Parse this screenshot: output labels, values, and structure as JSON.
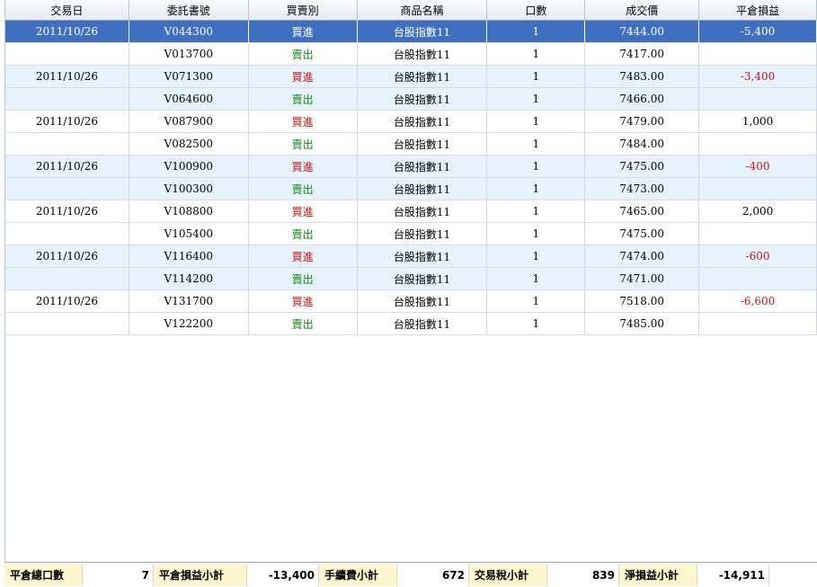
{
  "columns": [
    "交易日",
    "委託書號",
    "買賣別",
    "商品名稱",
    "口數",
    "成交價",
    "平倉損益"
  ],
  "rows": [
    {
      "date": "2011/10/26",
      "order": "V044300",
      "side": "買進",
      "side_type": "buy",
      "product": "台股指數11",
      "qty": "1",
      "price": "7444.00",
      "pnl": "-5,400",
      "pnl_type": "neg",
      "style": "sel"
    },
    {
      "date": "",
      "order": "V013700",
      "side": "賣出",
      "side_type": "sell",
      "product": "台股指數11",
      "qty": "1",
      "price": "7417.00",
      "pnl": "",
      "pnl_type": "",
      "style": "plain"
    },
    {
      "date": "2011/10/26",
      "order": "V071300",
      "side": "買進",
      "side_type": "buy",
      "product": "台股指數11",
      "qty": "1",
      "price": "7483.00",
      "pnl": "-3,400",
      "pnl_type": "neg",
      "style": "alt"
    },
    {
      "date": "",
      "order": "V064600",
      "side": "賣出",
      "side_type": "sell",
      "product": "台股指數11",
      "qty": "1",
      "price": "7466.00",
      "pnl": "",
      "pnl_type": "",
      "style": "alt"
    },
    {
      "date": "2011/10/26",
      "order": "V087900",
      "side": "買進",
      "side_type": "buy",
      "product": "台股指數11",
      "qty": "1",
      "price": "7479.00",
      "pnl": "1,000",
      "pnl_type": "pos",
      "style": "plain"
    },
    {
      "date": "",
      "order": "V082500",
      "side": "賣出",
      "side_type": "sell",
      "product": "台股指數11",
      "qty": "1",
      "price": "7484.00",
      "pnl": "",
      "pnl_type": "",
      "style": "plain"
    },
    {
      "date": "2011/10/26",
      "order": "V100900",
      "side": "買進",
      "side_type": "buy",
      "product": "台股指數11",
      "qty": "1",
      "price": "7475.00",
      "pnl": "-400",
      "pnl_type": "neg",
      "style": "alt"
    },
    {
      "date": "",
      "order": "V100300",
      "side": "賣出",
      "side_type": "sell",
      "product": "台股指數11",
      "qty": "1",
      "price": "7473.00",
      "pnl": "",
      "pnl_type": "",
      "style": "alt"
    },
    {
      "date": "2011/10/26",
      "order": "V108800",
      "side": "買進",
      "side_type": "buy",
      "product": "台股指數11",
      "qty": "1",
      "price": "7465.00",
      "pnl": "2,000",
      "pnl_type": "pos",
      "style": "plain"
    },
    {
      "date": "",
      "order": "V105400",
      "side": "賣出",
      "side_type": "sell",
      "product": "台股指數11",
      "qty": "1",
      "price": "7475.00",
      "pnl": "",
      "pnl_type": "",
      "style": "plain"
    },
    {
      "date": "2011/10/26",
      "order": "V116400",
      "side": "買進",
      "side_type": "buy",
      "product": "台股指數11",
      "qty": "1",
      "price": "7474.00",
      "pnl": "-600",
      "pnl_type": "neg",
      "style": "alt"
    },
    {
      "date": "",
      "order": "V114200",
      "side": "賣出",
      "side_type": "sell",
      "product": "台股指數11",
      "qty": "1",
      "price": "7471.00",
      "pnl": "",
      "pnl_type": "",
      "style": "alt"
    },
    {
      "date": "2011/10/26",
      "order": "V131700",
      "side": "買進",
      "side_type": "buy",
      "product": "台股指數11",
      "qty": "1",
      "price": "7518.00",
      "pnl": "-6,600",
      "pnl_type": "neg",
      "style": "plain"
    },
    {
      "date": "",
      "order": "V122200",
      "side": "賣出",
      "side_type": "sell",
      "product": "台股指數11",
      "qty": "1",
      "price": "7485.00",
      "pnl": "",
      "pnl_type": "",
      "style": "plain"
    }
  ],
  "summary": {
    "total_lots_label": "平倉總口數",
    "total_lots": "7",
    "pnl_subtotal_label": "平倉損益小計",
    "pnl_subtotal": "-13,400",
    "fee_subtotal_label": "手續費小計",
    "fee_subtotal": "672",
    "tax_subtotal_label": "交易稅小計",
    "tax_subtotal": "839",
    "net_pnl_label": "淨損益小計",
    "net_pnl": "-14,911"
  },
  "colors": {
    "buy": "#c81414",
    "sell": "#118a11",
    "selected_row": "#3f6fbf",
    "alt_row": "#e6f3fc",
    "summary_label_bg": "#fdf6cf"
  }
}
